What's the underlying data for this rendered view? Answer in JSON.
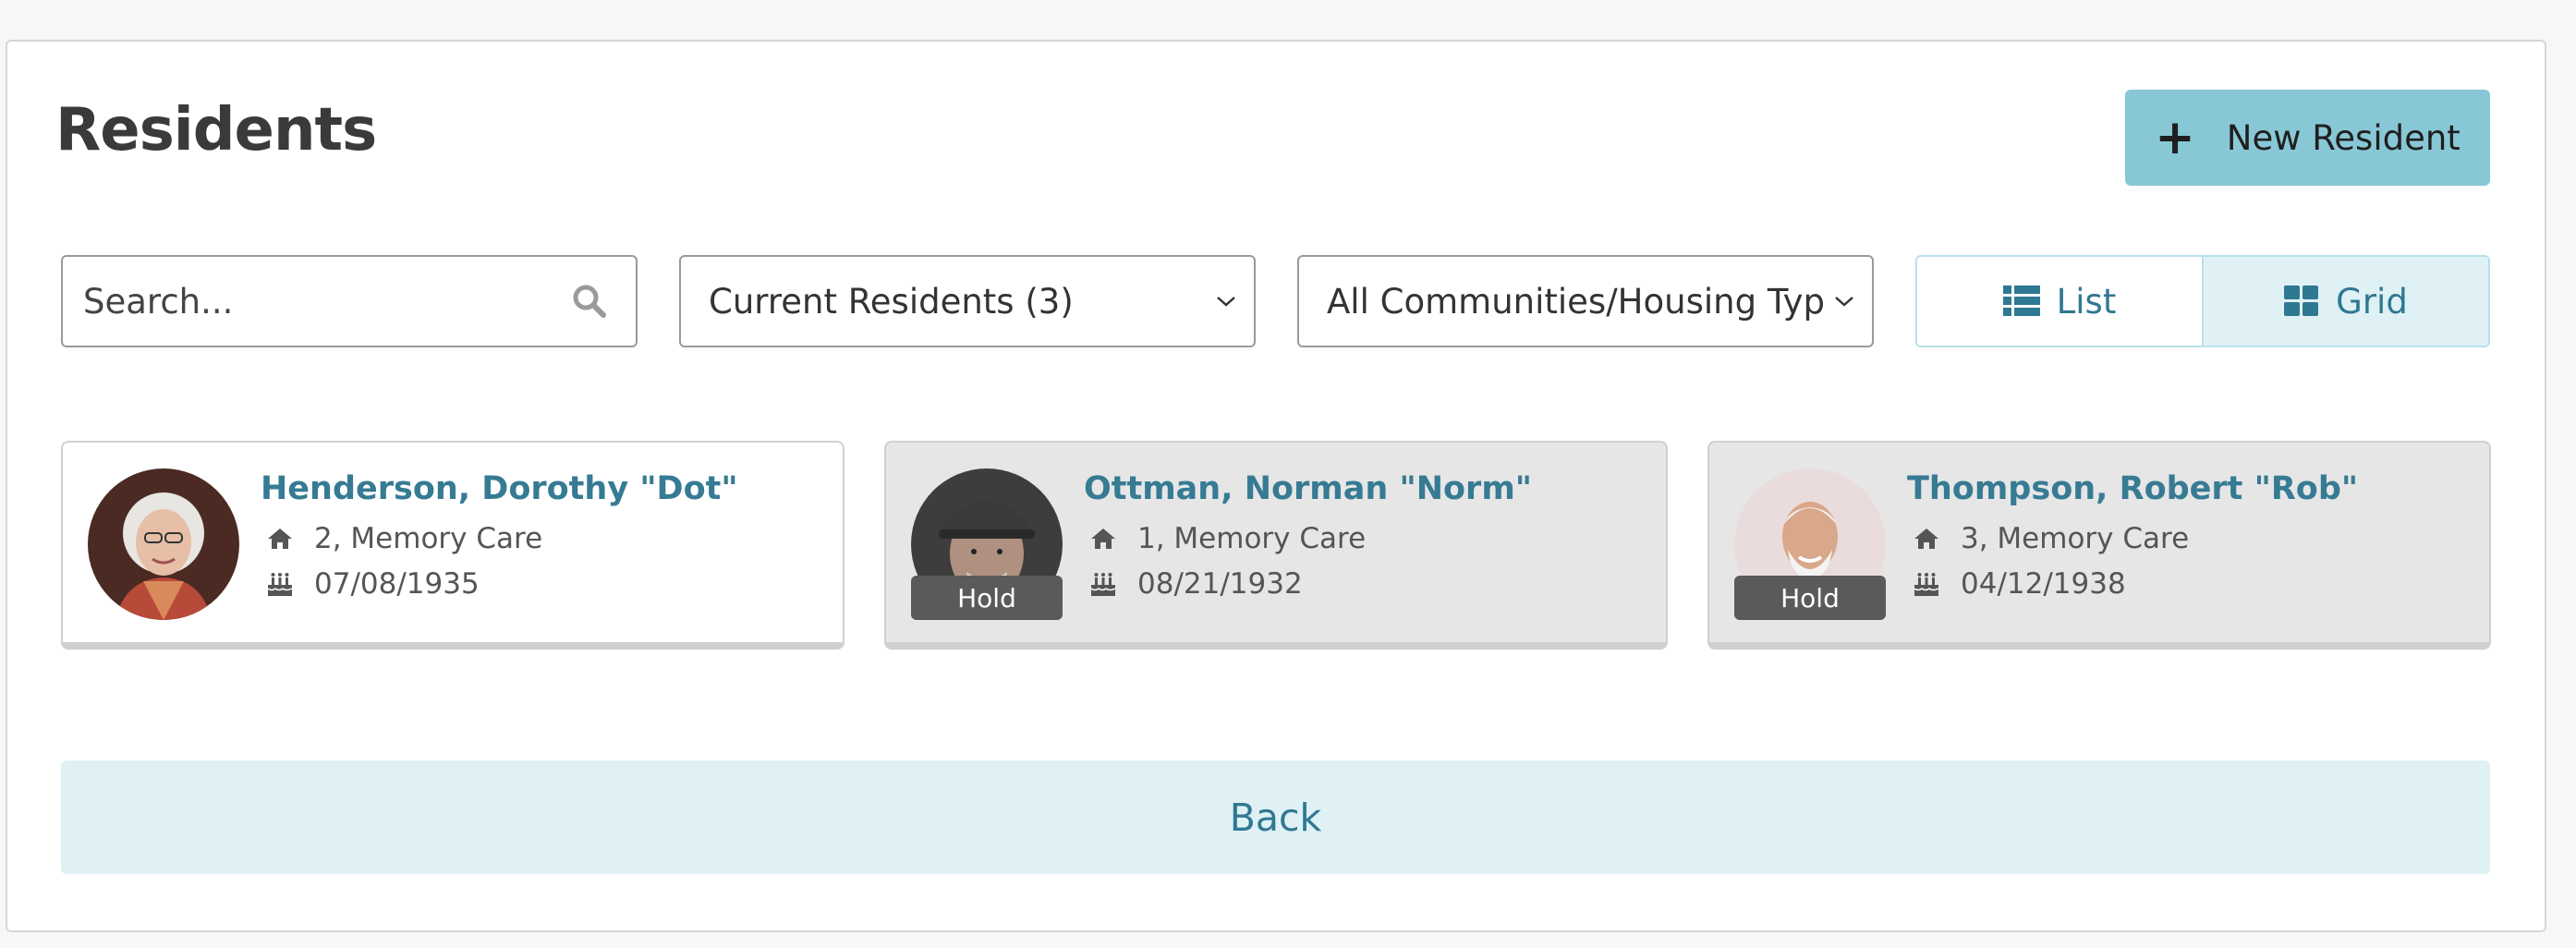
{
  "header": {
    "title": "Residents",
    "new_button_label": "New Resident",
    "new_button_icon": "plus-icon"
  },
  "filters": {
    "search": {
      "placeholder": "Search...",
      "icon": "search-icon"
    },
    "status_select": {
      "value": "Current Residents (3)"
    },
    "community_select": {
      "value": "All Communities/Housing Types"
    }
  },
  "view_toggle": {
    "list_label": "List",
    "grid_label": "Grid",
    "selected": "Grid"
  },
  "residents": [
    {
      "name": "Henderson, Dorothy \"Dot\"",
      "location": "2, Memory Care",
      "birthdate": "07/08/1935",
      "hold": false,
      "hold_label": ""
    },
    {
      "name": "Ottman, Norman \"Norm\"",
      "location": "1, Memory Care",
      "birthdate": "08/21/1932",
      "hold": true,
      "hold_label": "Hold"
    },
    {
      "name": "Thompson, Robert \"Rob\"",
      "location": "3, Memory Care",
      "birthdate": "04/12/1938",
      "hold": true,
      "hold_label": "Hold"
    }
  ],
  "footer": {
    "back_label": "Back"
  },
  "colors": {
    "accent": "#88c8d6",
    "link": "#367b93",
    "toggle_active": "#dff1f5",
    "hold_badge": "#5a5a5a"
  }
}
